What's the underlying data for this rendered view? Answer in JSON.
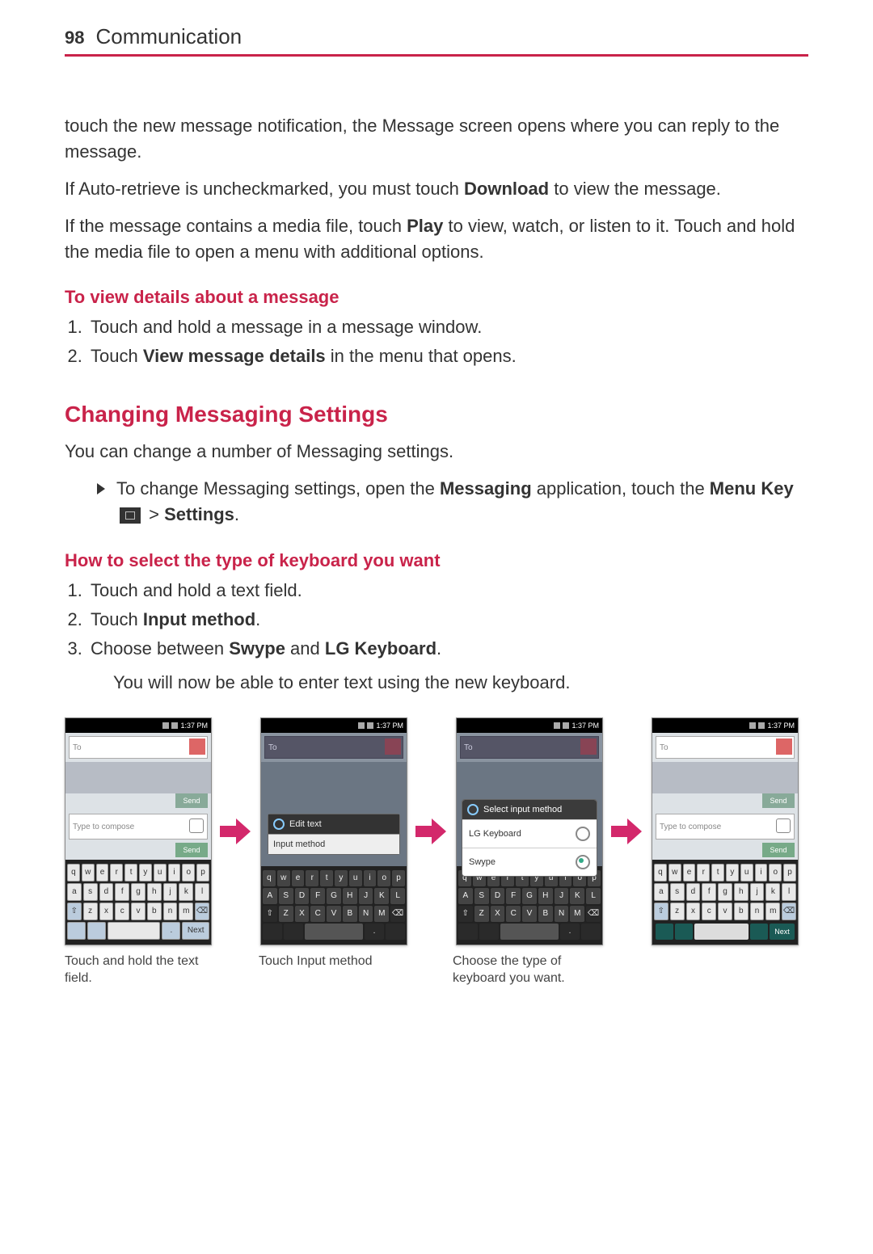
{
  "page_number": "98",
  "chapter_title": "Communication",
  "p1": "touch the new message notification, the Message screen opens where you can reply to the message.",
  "p2_pre": "If Auto-retrieve is uncheckmarked, you must touch ",
  "p2_bold": "Download",
  "p2_post": " to view the message.",
  "p3_pre": "If the message contains a media file, touch ",
  "p3_bold": "Play",
  "p3_post": " to view, watch, or listen to it. Touch and hold the media file to open a menu with additional options.",
  "sub1": "To view details about a message",
  "sub1_li1": "Touch and hold a message in a message window.",
  "sub1_li2_pre": "Touch ",
  "sub1_li2_bold": "View message details",
  "sub1_li2_post": " in the menu that opens.",
  "h2": "Changing Messaging Settings",
  "h2_p": "You can change a number of Messaging settings.",
  "bullet_pre": "To change Messaging settings, open the ",
  "bullet_b1": "Messaging",
  "bullet_mid": " application, touch the ",
  "bullet_b2": "Menu Key",
  "bullet_gt": " > ",
  "bullet_b3": "Settings",
  "bullet_end": ".",
  "sub2": "How to select the type of keyboard you want",
  "sub2_li1": "Touch and hold a text field.",
  "sub2_li2_pre": "Touch ",
  "sub2_li2_bold": "Input method",
  "sub2_li2_post": ".",
  "sub2_li3_pre": "Choose between ",
  "sub2_li3_b1": "Swype",
  "sub2_li3_mid": " and ",
  "sub2_li3_b2": "LG Keyboard",
  "sub2_li3_post": ".",
  "sub2_p": "You will now be able to enter text using the new keyboard.",
  "screens": {
    "status_time": "1:37 PM",
    "to_label": "To",
    "compose_placeholder": "Type to compose",
    "send": "Send",
    "row1": [
      "q",
      "w",
      "e",
      "r",
      "t",
      "y",
      "u",
      "i",
      "o",
      "p"
    ],
    "row2": [
      "a",
      "s",
      "d",
      "f",
      "g",
      "h",
      "j",
      "k",
      "l"
    ],
    "row2u": [
      "A",
      "S",
      "D",
      "F",
      "G",
      "H",
      "J",
      "K",
      "L"
    ],
    "row3": [
      "z",
      "x",
      "c",
      "v",
      "b",
      "n",
      "m"
    ],
    "row3u": [
      "Z",
      "X",
      "C",
      "V",
      "B",
      "N",
      "M"
    ],
    "ctx_title": "Edit text",
    "ctx_item": "Input method",
    "dlg_title": "Select input method",
    "dlg_opt1": "LG Keyboard",
    "dlg_opt2": "Swype",
    "next": "Next"
  },
  "captions": {
    "c1": "Touch and hold the text field.",
    "c2": "Touch Input method",
    "c3": "Choose the type of keyboard you want."
  }
}
